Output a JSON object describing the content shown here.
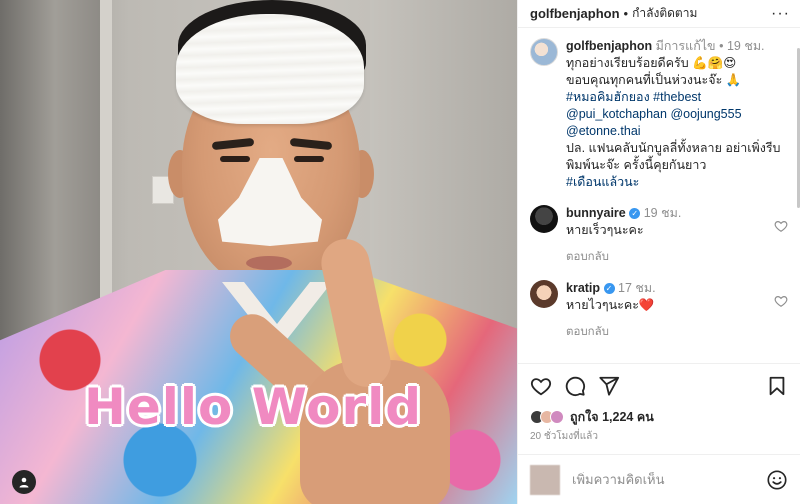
{
  "media": {
    "sticker_text": "Hello World"
  },
  "header": {
    "username": "golfbenjaphon",
    "separator": "•",
    "following_label": "กำลังติดตาม",
    "more_label": "···"
  },
  "caption": {
    "username": "golfbenjaphon",
    "edited_label": "มีการแก้ไข",
    "separator": "•",
    "time": "19 ชม.",
    "line1": "ทุกอย่างเรียบร้อยดีครับ 💪🤗😍",
    "line2": "ขอบคุณทุกคนที่เป็นห่วงนะจ๊ะ 🙏",
    "hashtag1": "#หมอคิมฮักยอง",
    "hashtag2": "#thebest",
    "mention1": "@pui_kotchaphan",
    "mention2": "@oojung555",
    "mention3": "@etonne.thai",
    "line3": "ปล. แฟนคลับนักบูลลี่ทั้งหลาย อย่าเพิ่งรีบพิมพ์นะจ๊ะ ครั้งนี้คุยกันยาว",
    "hashtag3": "#เดือนแล้วนะ"
  },
  "comments": [
    {
      "username": "bunnyaire",
      "time": "19 ชม.",
      "text": "หายเร็วๆนะคะ",
      "reply_label": "ตอบกลับ"
    },
    {
      "username": "kratip",
      "time": "17 ชม.",
      "text": "หายไวๆนะคะ❤️",
      "reply_label": "ตอบกลับ"
    }
  ],
  "likes": {
    "label": "ถูกใจ",
    "count": "1,224",
    "unit": "คน"
  },
  "time_ago": "20 ชั่วโมงที่แล้ว",
  "add_comment": {
    "placeholder": "เพิ่มความคิดเห็น"
  },
  "colors": {
    "verified": "#3897f0",
    "link": "#00376b",
    "sticker": "#f08ac1"
  }
}
